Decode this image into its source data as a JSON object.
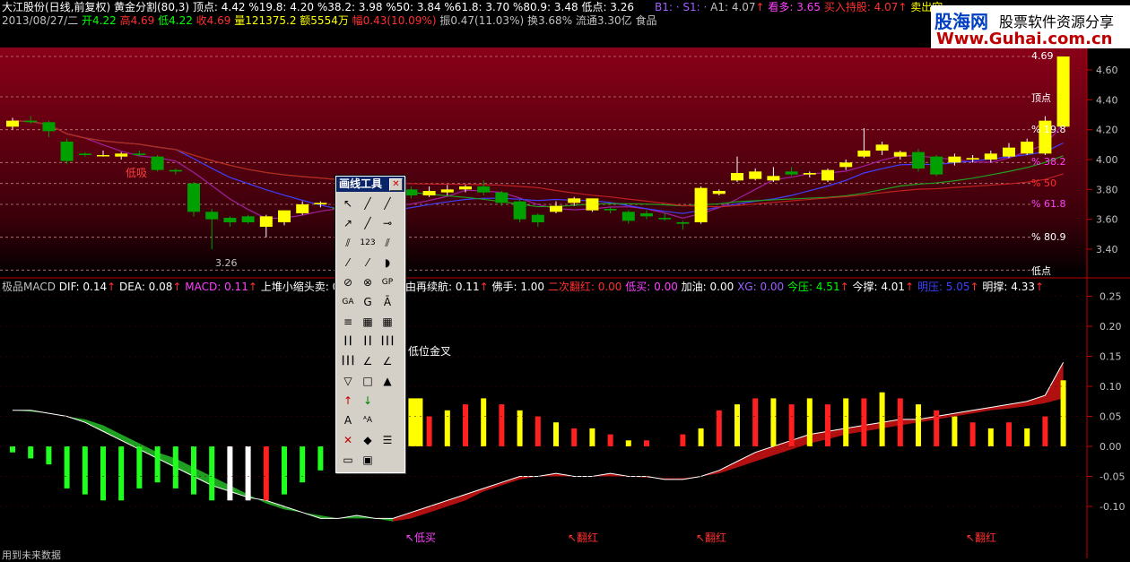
{
  "header": {
    "line1": [
      {
        "text": "大江股份(日线,前复权)",
        "color": "#ffffff"
      },
      {
        "text": " 黄金分割(80,3)",
        "color": "#ffffff"
      },
      {
        "text": "  顶点: 4.42",
        "color": "#ffffff"
      },
      {
        "text": " %19.8: 4.20",
        "color": "#ffffff"
      },
      {
        "text": " %38.2: 3.98",
        "color": "#ffffff"
      },
      {
        "text": " %50: 3.84",
        "color": "#ffffff"
      },
      {
        "text": " %61.8: 3.70",
        "color": "#ffffff"
      },
      {
        "text": " %80.9: 3.48",
        "color": "#ffffff"
      },
      {
        "text": " 低点: 3.26",
        "color": "#ffffff"
      }
    ],
    "line1_right": [
      {
        "text": "B1: ·",
        "color": "#a060ff"
      },
      {
        "text": " S1: ·",
        "color": "#a060ff"
      },
      {
        "text": " A1: 4.07",
        "color": "#c0c0c0"
      },
      {
        "text": "↑",
        "color": "#ff3030"
      },
      {
        "text": " 看多: 3.65",
        "color": "#ff40ff"
      },
      {
        "text": " 买入持股: 4.07",
        "color": "#ff3030"
      },
      {
        "text": "↑",
        "color": "#ff3030"
      },
      {
        "text": " 卖出空",
        "color": "#ffff00"
      }
    ],
    "line2": [
      {
        "text": "2013/08/27/二",
        "color": "#c0c0c0"
      },
      {
        "text": " 开4.22",
        "color": "#00ff00"
      },
      {
        "text": " 高4.69",
        "color": "#ff3030"
      },
      {
        "text": " 低4.22",
        "color": "#00ff00"
      },
      {
        "text": " 收4.69",
        "color": "#ff3030"
      },
      {
        "text": " 量121375.2",
        "color": "#ffff00"
      },
      {
        "text": " 额5554万",
        "color": "#ffff00"
      },
      {
        "text": " 幅0.43(10.09%)",
        "color": "#ff3030"
      },
      {
        "text": " 振0.47(11.03%)",
        "color": "#c0c0c0"
      },
      {
        "text": " 换3.68%",
        "color": "#c0c0c0"
      },
      {
        "text": " 流通3.30亿",
        "color": "#c0c0c0"
      },
      {
        "text": " 食品",
        "color": "#c0c0c0"
      }
    ]
  },
  "brand": {
    "name": "股海网",
    "slogan": "股票软件资源分享",
    "url": "Www.Guhai.com.cn"
  },
  "price_axis": {
    "labels": [
      "4.60",
      "4.40",
      "4.20",
      "4.00",
      "3.80",
      "3.60",
      "3.40"
    ],
    "min": 3.26,
    "max": 4.69
  },
  "fib_labels": [
    {
      "text": "4.69",
      "color": "#ffffff",
      "value": 4.69
    },
    {
      "text": "顶点",
      "color": "#ffffff",
      "value": 4.42
    },
    {
      "text": "19.8",
      "color": "#ffffff",
      "value": 4.2
    },
    {
      "text": "38.2",
      "color": "#ff40ff",
      "value": 3.98
    },
    {
      "text": "50",
      "color": "#ff3030",
      "value": 3.84
    },
    {
      "text": "61.8",
      "color": "#ff40ff",
      "value": 3.7
    },
    {
      "text": "80.9",
      "color": "#ffffff",
      "value": 3.48
    },
    {
      "text": "低点",
      "color": "#ffffff",
      "value": 3.26
    }
  ],
  "annotations": {
    "low_label": "低吸",
    "low_price": "3.26",
    "low_cross": "低位金叉",
    "buy_low": "↖低买",
    "turn_red_1": "↖翻红",
    "turn_red_2": "↖翻红",
    "turn_red_3": "↖翻红",
    "footer": "用到未来数据"
  },
  "macd_header": [
    {
      "text": "极品MACD",
      "color": "#c0c0c0"
    },
    {
      "text": " DIF: 0.14",
      "color": "#ffffff"
    },
    {
      "text": "↑",
      "color": "#ff3030"
    },
    {
      "text": "  DEA: 0.08",
      "color": "#ffffff"
    },
    {
      "text": "↑",
      "color": "#ff3030"
    },
    {
      "text": "  MACD: 0.11",
      "color": "#ff40ff"
    },
    {
      "text": "↑",
      "color": "#ff3030"
    },
    {
      "text": "   上堆小缩头卖: 0",
      "color": "#ffffff"
    }
  ],
  "macd_header_right": [
    {
      "text": "由再续航: 0.11",
      "color": "#ffffff"
    },
    {
      "text": "↑",
      "color": "#ff3030"
    },
    {
      "text": "   佛手: 1.00",
      "color": "#ffffff"
    },
    {
      "text": "   二次翻红: 0.00",
      "color": "#ff3030"
    },
    {
      "text": "  低买: 0.00",
      "color": "#ff40ff"
    },
    {
      "text": "  加油: 0.00",
      "color": "#ffffff"
    },
    {
      "text": "      XG: 0.00",
      "color": "#a060ff"
    },
    {
      "text": "  今压: 4.51",
      "color": "#00ff00"
    },
    {
      "text": "↑",
      "color": "#ff3030"
    },
    {
      "text": "  今撑: 4.01",
      "color": "#ffffff"
    },
    {
      "text": "↑",
      "color": "#ff3030"
    },
    {
      "text": "  明压: 5.05",
      "color": "#4040ff"
    },
    {
      "text": "↑",
      "color": "#ff3030"
    },
    {
      "text": "  明撑: 4.33",
      "color": "#ffffff"
    },
    {
      "text": "↑",
      "color": "#ff3030"
    }
  ],
  "macd_axis": {
    "labels": [
      "0.25",
      "0.20",
      "0.15",
      "0.10",
      "0.05",
      "0.00",
      "-0.05",
      "-0.10"
    ]
  },
  "toolbox": {
    "title": "画线工具",
    "close": "✕",
    "tools": [
      {
        "name": "pointer-tool",
        "glyph": "↖"
      },
      {
        "name": "line-tool",
        "glyph": "╱"
      },
      {
        "name": "ray-tool",
        "glyph": "╱"
      },
      {
        "name": "arrow-line-tool",
        "glyph": "↗"
      },
      {
        "name": "segment-tool",
        "glyph": "╱"
      },
      {
        "name": "horizontal-tool",
        "glyph": "⊸"
      },
      {
        "name": "parallel-tool",
        "glyph": "⫽"
      },
      {
        "name": "label-123-tool",
        "glyph": "123"
      },
      {
        "name": "channel-tool",
        "glyph": "⫽"
      },
      {
        "name": "fan-tool",
        "glyph": "⁄"
      },
      {
        "name": "speed-line-tool",
        "glyph": "⁄"
      },
      {
        "name": "arc-tool",
        "glyph": "◗"
      },
      {
        "name": "circle-tool",
        "glyph": "⊘"
      },
      {
        "name": "cycle-tool",
        "glyph": "⊗"
      },
      {
        "name": "gp-tool",
        "glyph": "GP"
      },
      {
        "name": "ga-tool",
        "glyph": "GA"
      },
      {
        "name": "g-tool",
        "glyph": "G"
      },
      {
        "name": "ga2-tool",
        "glyph": "Ā"
      },
      {
        "name": "fib-tool",
        "glyph": "≡"
      },
      {
        "name": "gann-tool",
        "glyph": "▦"
      },
      {
        "name": "grid-tool",
        "glyph": "▦"
      },
      {
        "name": "period-tool",
        "glyph": "┃┃"
      },
      {
        "name": "golden-tool",
        "glyph": "┃┃"
      },
      {
        "name": "time-tool",
        "glyph": "┃┃┃"
      },
      {
        "name": "lines-tool",
        "glyph": "┃┃┃"
      },
      {
        "name": "angle-tool",
        "glyph": "∠"
      },
      {
        "name": "wave-tool",
        "glyph": "∠"
      },
      {
        "name": "triangle-tool",
        "glyph": "▽"
      },
      {
        "name": "rect-tool",
        "glyph": "□"
      },
      {
        "name": "mark-tool",
        "glyph": "▲"
      },
      {
        "name": "up-arrow-tool",
        "glyph": "↑"
      },
      {
        "name": "down-arrow-tool",
        "glyph": "↓"
      },
      {
        "name": "blank-tool",
        "glyph": ""
      },
      {
        "name": "text-tool",
        "glyph": "A"
      },
      {
        "name": "text2-tool",
        "glyph": "ᴬA"
      },
      {
        "name": "blank2-tool",
        "glyph": ""
      },
      {
        "name": "delete-tool",
        "glyph": "✕"
      },
      {
        "name": "shapes-tool",
        "glyph": "◆"
      },
      {
        "name": "list-tool",
        "glyph": "☰"
      },
      {
        "name": "ruler-tool",
        "glyph": "▭"
      },
      {
        "name": "note-tool",
        "glyph": "▣"
      }
    ]
  },
  "colors": {
    "bg": "#000000",
    "up": "#ffff00",
    "down": "#00a000",
    "axis": "#c00000",
    "fib_bg_top": "#8a0018",
    "fib_bg_bottom": "#000000"
  },
  "candles": [
    [
      4.22,
      4.28,
      4.2,
      4.26
    ],
    [
      4.26,
      4.29,
      4.24,
      4.25
    ],
    [
      4.25,
      4.26,
      4.15,
      4.19
    ],
    [
      4.12,
      4.14,
      3.97,
      3.99
    ],
    [
      4.04,
      4.05,
      4.02,
      4.03
    ],
    [
      4.03,
      4.06,
      4.02,
      4.03
    ],
    [
      4.02,
      4.05,
      4.0,
      4.04
    ],
    [
      4.04,
      4.06,
      4.02,
      4.03
    ],
    [
      4.02,
      4.03,
      3.92,
      3.93
    ],
    [
      3.93,
      3.94,
      3.9,
      3.92
    ],
    [
      3.84,
      3.85,
      3.62,
      3.65
    ],
    [
      3.65,
      3.67,
      3.4,
      3.6
    ],
    [
      3.61,
      3.62,
      3.55,
      3.58
    ],
    [
      3.62,
      3.63,
      3.57,
      3.58
    ],
    [
      3.55,
      3.63,
      3.48,
      3.62
    ],
    [
      3.58,
      3.66,
      3.56,
      3.66
    ],
    [
      3.64,
      3.72,
      3.63,
      3.7
    ],
    [
      3.7,
      3.72,
      3.68,
      3.71
    ],
    [
      3.68,
      3.72,
      3.63,
      3.67
    ],
    [
      3.7,
      3.74,
      3.64,
      3.66
    ],
    [
      3.66,
      3.7,
      3.62,
      3.62
    ],
    [
      3.64,
      3.76,
      3.62,
      3.8
    ],
    [
      3.8,
      3.82,
      3.74,
      3.76
    ],
    [
      3.76,
      3.82,
      3.75,
      3.79
    ],
    [
      3.78,
      3.83,
      3.76,
      3.8
    ],
    [
      3.8,
      3.83,
      3.78,
      3.82
    ],
    [
      3.82,
      3.86,
      3.76,
      3.78
    ],
    [
      3.78,
      3.79,
      3.69,
      3.71
    ],
    [
      3.72,
      3.73,
      3.58,
      3.6
    ],
    [
      3.63,
      3.64,
      3.55,
      3.58
    ],
    [
      3.65,
      3.72,
      3.64,
      3.69
    ],
    [
      3.71,
      3.75,
      3.69,
      3.74
    ],
    [
      3.66,
      3.74,
      3.65,
      3.74
    ],
    [
      3.67,
      3.68,
      3.64,
      3.66
    ],
    [
      3.65,
      3.66,
      3.57,
      3.59
    ],
    [
      3.64,
      3.66,
      3.6,
      3.62
    ],
    [
      3.61,
      3.64,
      3.59,
      3.6
    ],
    [
      3.58,
      3.59,
      3.53,
      3.57
    ],
    [
      3.58,
      3.82,
      3.57,
      3.81
    ],
    [
      3.77,
      3.8,
      3.76,
      3.79
    ],
    [
      3.86,
      4.02,
      3.85,
      3.91
    ],
    [
      3.87,
      3.94,
      3.86,
      3.92
    ],
    [
      3.86,
      3.95,
      3.85,
      3.89
    ],
    [
      3.92,
      3.95,
      3.89,
      3.9
    ],
    [
      3.9,
      3.92,
      3.88,
      3.91
    ],
    [
      3.86,
      3.94,
      3.85,
      3.93
    ],
    [
      3.95,
      4.0,
      3.93,
      3.98
    ],
    [
      4.02,
      4.21,
      4.01,
      4.06
    ],
    [
      4.06,
      4.12,
      4.03,
      4.1
    ],
    [
      4.02,
      4.06,
      4.0,
      4.05
    ],
    [
      4.05,
      4.07,
      3.92,
      3.94
    ],
    [
      4.02,
      4.03,
      3.89,
      3.9
    ],
    [
      3.98,
      4.04,
      3.96,
      4.02
    ],
    [
      4.0,
      4.03,
      3.98,
      4.01
    ],
    [
      4.0,
      4.06,
      3.98,
      4.04
    ],
    [
      4.02,
      4.11,
      4.01,
      4.08
    ],
    [
      4.04,
      4.14,
      4.03,
      4.12
    ],
    [
      4.04,
      4.29,
      4.03,
      4.26
    ],
    [
      4.22,
      4.69,
      4.22,
      4.69
    ]
  ],
  "macd_bars": [
    -0.01,
    -0.02,
    -0.03,
    -0.07,
    -0.08,
    -0.09,
    -0.09,
    -0.07,
    -0.06,
    -0.07,
    -0.08,
    -0.09,
    -0.09,
    -0.09,
    -0.09,
    -0.08,
    -0.06,
    -0.04,
    -0.03,
    -0.01,
    0.0,
    0.02,
    0.08,
    0.05,
    0.06,
    0.07,
    0.08,
    0.07,
    0.06,
    0.05,
    0.04,
    0.03,
    0.03,
    0.02,
    0.01,
    0.01,
    0.0,
    0.02,
    0.03,
    0.06,
    0.07,
    0.08,
    0.08,
    0.07,
    0.08,
    0.07,
    0.08,
    0.08,
    0.09,
    0.08,
    0.07,
    0.06,
    0.05,
    0.04,
    0.03,
    0.04,
    0.03,
    0.05,
    0.11
  ],
  "diff_line": [
    0.06,
    0.06,
    0.055,
    0.05,
    0.04,
    0.025,
    0.01,
    -0.005,
    -0.02,
    -0.035,
    -0.05,
    -0.065,
    -0.075,
    -0.085,
    -0.09,
    -0.1,
    -0.11,
    -0.12,
    -0.12,
    -0.115,
    -0.12,
    -0.12,
    -0.11,
    -0.1,
    -0.09,
    -0.08,
    -0.07,
    -0.06,
    -0.05,
    -0.05,
    -0.045,
    -0.05,
    -0.05,
    -0.045,
    -0.05,
    -0.05,
    -0.055,
    -0.055,
    -0.05,
    -0.04,
    -0.025,
    -0.01,
    0.0,
    0.01,
    0.02,
    0.025,
    0.03,
    0.035,
    0.04,
    0.045,
    0.045,
    0.05,
    0.055,
    0.06,
    0.065,
    0.07,
    0.075,
    0.085,
    0.14
  ],
  "dea_line": [
    0.06,
    0.058,
    0.055,
    0.05,
    0.045,
    0.035,
    0.02,
    0.005,
    -0.01,
    -0.02,
    -0.035,
    -0.05,
    -0.065,
    -0.08,
    -0.095,
    -0.105,
    -0.11,
    -0.115,
    -0.12,
    -0.12,
    -0.12,
    -0.125,
    -0.12,
    -0.11,
    -0.1,
    -0.09,
    -0.075,
    -0.065,
    -0.055,
    -0.05,
    -0.05,
    -0.05,
    -0.05,
    -0.05,
    -0.05,
    -0.052,
    -0.053,
    -0.053,
    -0.05,
    -0.045,
    -0.035,
    -0.025,
    -0.015,
    -0.005,
    0.005,
    0.012,
    0.02,
    0.025,
    0.03,
    0.035,
    0.04,
    0.045,
    0.05,
    0.055,
    0.06,
    0.063,
    0.067,
    0.072,
    0.08
  ]
}
